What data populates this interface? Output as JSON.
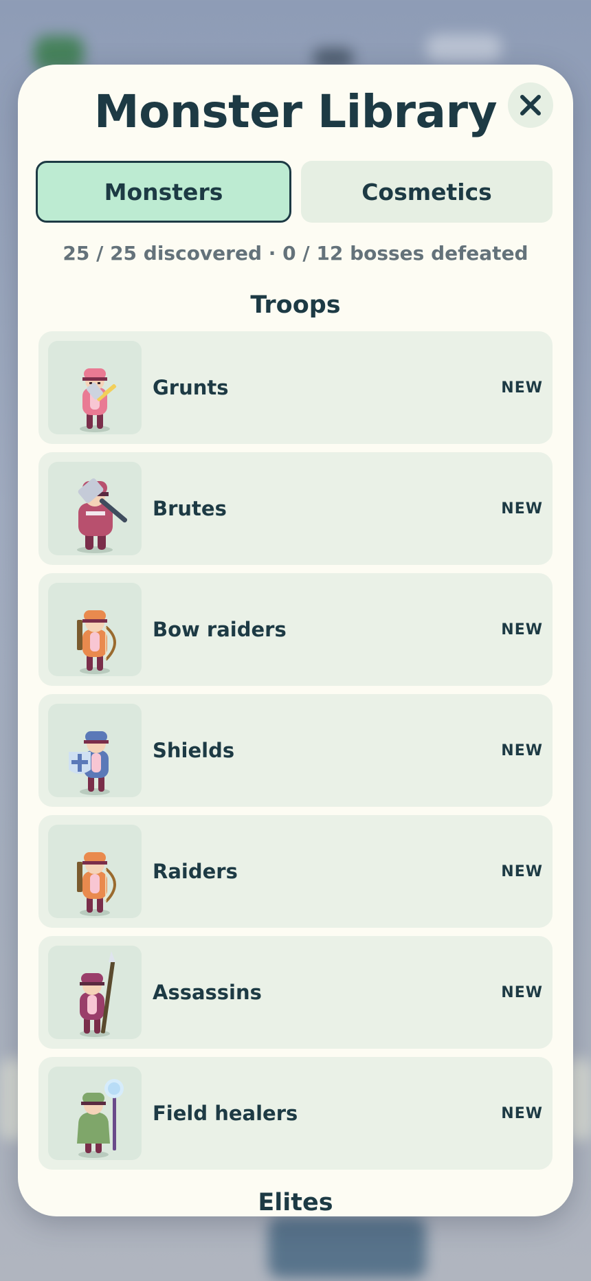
{
  "modal": {
    "title": "Monster Library",
    "close_icon": "close-icon"
  },
  "tabs": [
    {
      "label": "Monsters",
      "active": true
    },
    {
      "label": "Cosmetics",
      "active": false
    }
  ],
  "summary": "25 / 25 discovered · 0 / 12 bosses defeated",
  "sections": [
    {
      "title": "Troops",
      "items": [
        {
          "name": "Grunts",
          "badge": "NEW",
          "icon": "grunt-sword-icon"
        },
        {
          "name": "Brutes",
          "badge": "NEW",
          "icon": "brute-hammer-icon"
        },
        {
          "name": "Bow raiders",
          "badge": "NEW",
          "icon": "bow-raider-icon"
        },
        {
          "name": "Shields",
          "badge": "NEW",
          "icon": "shield-bearer-icon"
        },
        {
          "name": "Raiders",
          "badge": "NEW",
          "icon": "raider-bow-icon"
        },
        {
          "name": "Assassins",
          "badge": "NEW",
          "icon": "assassin-spear-icon"
        },
        {
          "name": "Field healers",
          "badge": "NEW",
          "icon": "healer-staff-icon"
        }
      ]
    },
    {
      "title": "Elites",
      "items": []
    }
  ],
  "colors": {
    "accent": "#bdebd2",
    "ink": "#1d3a44",
    "panel": "#fdfcf3",
    "row": "#eaf1e7"
  }
}
